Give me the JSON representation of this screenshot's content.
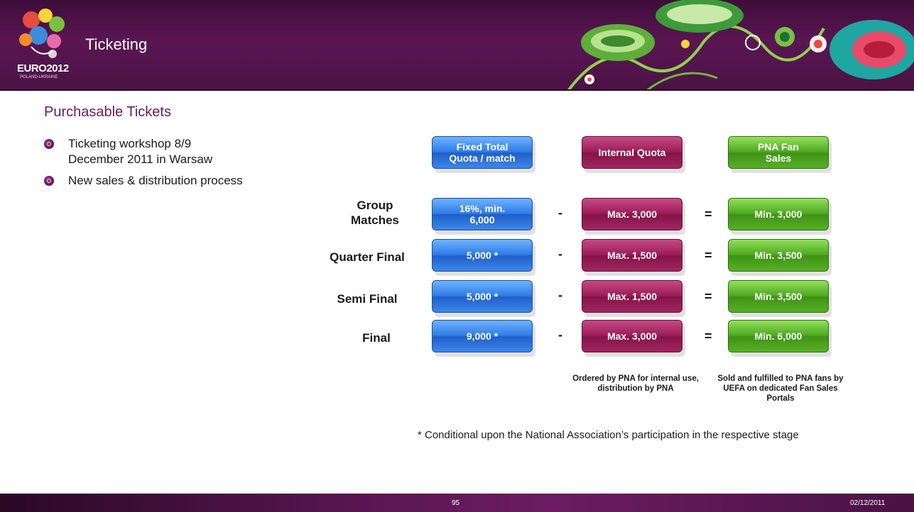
{
  "header": {
    "title": "Ticketing",
    "logo_text": "EURO2012",
    "logo_subtext": "POLAND-UKRAINE",
    "colors": {
      "band": "#4a1245",
      "title": "#6b1a5e"
    }
  },
  "page_title": "Purchasable Tickets",
  "bullets": [
    "Ticketing workshop 8/9 December 2011 in Warsaw",
    "New sales & distribution process"
  ],
  "table": {
    "headers": [
      "Fixed Total Quota / match",
      "Internal Quota",
      "PNA Fan Sales"
    ],
    "rows": [
      {
        "label": "Group Matches",
        "fixed": "16%, min. 6,000",
        "internal": "Max. 3,000",
        "fan": "Min. 3,000"
      },
      {
        "label": "Quarter Final",
        "fixed": "5,000 *",
        "internal": "Max. 1,500",
        "fan": "Min. 3,500"
      },
      {
        "label": "Semi Final",
        "fixed": "5,000 *",
        "internal": "Max. 1,500",
        "fan": "Min. 3,500"
      },
      {
        "label": "Final",
        "fixed": "9,000 *",
        "internal": "Max. 3,000",
        "fan": "Min. 6,000"
      }
    ],
    "minus": "-",
    "equals": "=",
    "notes": {
      "internal": "Ordered by PNA for internal use, distribution by PNA",
      "fan": "Sold and fulfilled to PNA fans by UEFA on dedicated Fan Sales Portals"
    },
    "colors": {
      "fixed": "#2f7be6",
      "internal": "#9a1d57",
      "fan": "#4ea820"
    }
  },
  "footnote": "* Conditional upon the National Association’s participation in the respective stage",
  "footer": {
    "page": "95",
    "date": "02/12/2011"
  }
}
